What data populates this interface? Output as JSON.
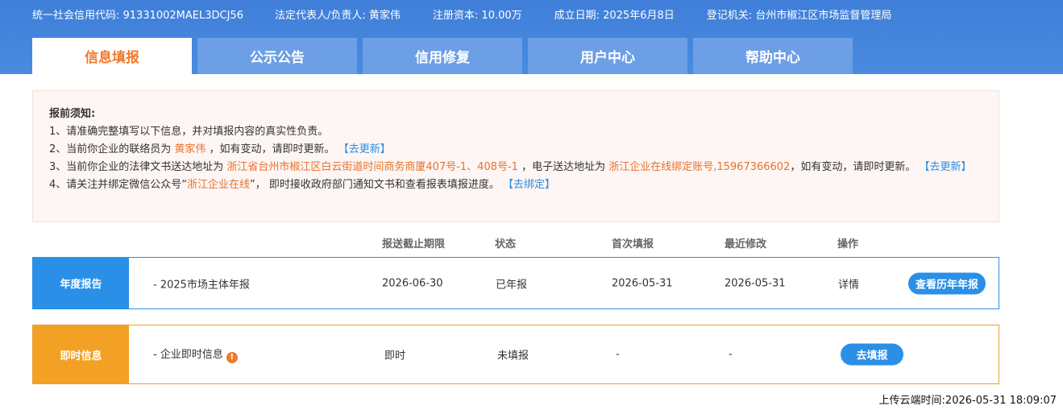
{
  "header": {
    "company_title": "",
    "info": [
      {
        "label": "统一社会信用代码: ",
        "value": "91331002MAEL3DCJ56"
      },
      {
        "label": "法定代表人/负责人: ",
        "value": "黄家伟"
      },
      {
        "label": "注册资本: ",
        "value": "10.00万"
      },
      {
        "label": "成立日期: ",
        "value": "2025年6月8日"
      },
      {
        "label": "登记机关: ",
        "value": "台州市椒江区市场监督管理局"
      }
    ]
  },
  "tabs": [
    "信息填报",
    "公示公告",
    "信用修复",
    "用户中心",
    "帮助中心"
  ],
  "notice": {
    "title": "报前须知:",
    "line1": "1、请准确完整填写以下信息，并对填报内容的真实性负责。",
    "line2_pre": "2、当前你企业的联络员为 ",
    "line2_name": "黄家伟",
    "line2_post": " ，如有变动，请即时更新。",
    "line2_link": "【去更新】",
    "line3_pre": "3、当前你企业的法律文书送达地址为 ",
    "line3_addr": "浙江省台州市椒江区白云街道时间商务商厦407号-1、408号-1",
    "line3_mid": " ，电子送达地址为 ",
    "line3_email": "浙江企业在线绑定账号,15967366602",
    "line3_post": "，如有变动，请即时更新。",
    "line3_link": "【去更新】",
    "line4_pre": "4、请关注并绑定微信公众号“",
    "line4_name": "浙江企业在线",
    "line4_post": "”， 即时接收政府部门通知文书和查看报表填报进度。",
    "line4_link": "【去绑定】"
  },
  "table": {
    "headers": {
      "deadline": "报送截止期限",
      "status": "状态",
      "first": "首次填报",
      "modified": "最近修改",
      "action": "操作"
    },
    "annual": {
      "label": "年度报告",
      "name": "- 2025市场主体年报",
      "deadline": "2026-06-30",
      "status": "已年报",
      "first": "2026-05-31",
      "modified": "2026-05-31",
      "detail_link": "详情",
      "history_button": "查看历年年报"
    },
    "instant": {
      "label": "即时信息",
      "name": "- 企业即时信息",
      "warn_icon": "!",
      "deadline": "即时",
      "status": "未填报",
      "first": "-",
      "modified": "-",
      "fill_button": "去填报"
    }
  },
  "upload_time": "上传云端时间:2026-05-31 18:09:07",
  "colors": {
    "header_bg": "#4a8ae0",
    "active_tab_text": "#f07a2c",
    "annual": "#2a8fe6",
    "instant": "#f2a124"
  }
}
